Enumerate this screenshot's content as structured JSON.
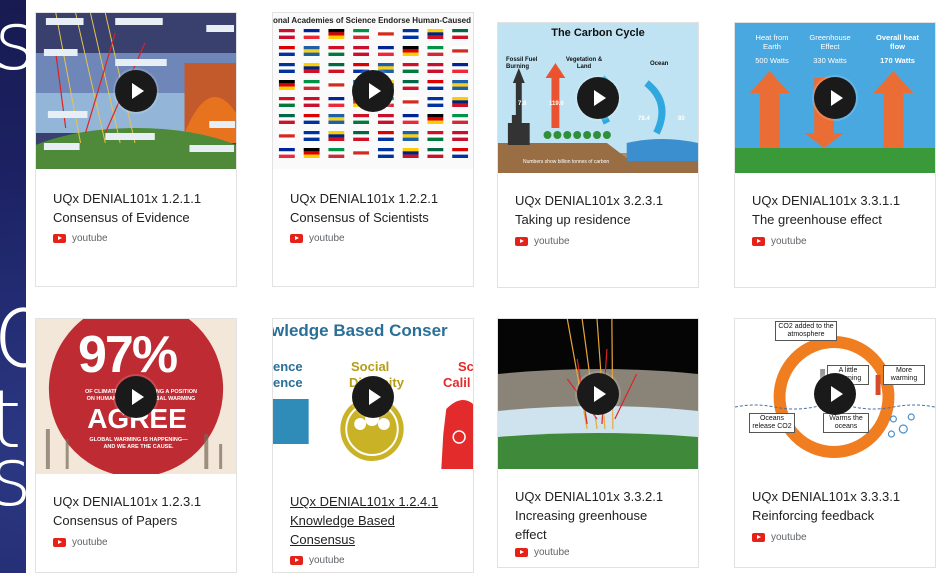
{
  "cards": [
    {
      "code": "UQx DENIAL101x 1.2.1.1",
      "name": "Consensus of Evidence",
      "source": "youtube"
    },
    {
      "code": "UQx DENIAL101x 1.2.2.1",
      "name": "Consensus of Scientists",
      "source": "youtube",
      "thumb_text": "onal Academies of Science Endorse Human-Caused Global W"
    },
    {
      "code": "UQx DENIAL101x 3.2.3.1",
      "name": "Taking up residence",
      "source": "youtube",
      "thumb": {
        "title": "The Carbon Cycle",
        "fossil": "Fossil Fuel Burning",
        "veg": "Vegetation & Land",
        "ocean": "Ocean",
        "v1": "7.8",
        "v2": "119.6",
        "v3": "78.4",
        "v4": "80",
        "note": "Numbers show billion tonnes of carbon"
      }
    },
    {
      "code": "UQx DENIAL101x 3.3.1.1",
      "name": "The greenhouse effect",
      "source": "youtube",
      "thumb": {
        "heat_label": "Heat from Earth",
        "heat_val": "500 Watts",
        "ghe_label": "Greenhouse Effect",
        "ghe_val": "330 Watts",
        "overall_label": "Overall heat flow",
        "overall_val": "170 Watts"
      }
    },
    {
      "code": "UQx DENIAL101x 1.2.3.1",
      "name": "Consensus of Papers",
      "source": "youtube",
      "thumb": {
        "big": "97%",
        "agree": "AGREE",
        "line1": "OF CLIMATE PAPERS TAKING A POSITION",
        "line2": "ON HUMAN-CAUSED GLOBAL WARMING",
        "line3": "GLOBAL WARMING IS HAPPENING—",
        "line4": "AND WE ARE THE CAUSE."
      }
    },
    {
      "code": "UQx DENIAL101x 1.2.4.1",
      "name": "Knowledge Based Consensus",
      "source": "youtube",
      "thumb": {
        "heading": "wledge Based Conser",
        "l1": "ence",
        "l2": "ence",
        "social1": "Social",
        "social2": "Diversity",
        "sc1": "Sc",
        "sc2": "Calil"
      }
    },
    {
      "code": "UQx DENIAL101x 3.3.2.1",
      "name": "Increasing greenhouse effect",
      "source": "youtube"
    },
    {
      "code": "UQx DENIAL101x 3.3.3.1",
      "name": "Reinforcing feedback",
      "source": "youtube",
      "thumb": {
        "co2": "CO2 added to the atmosphere",
        "little": "A little warming",
        "more": "More warming",
        "oceans_rel": "Oceans release CO2",
        "warms": "Warms the oceans"
      }
    }
  ]
}
